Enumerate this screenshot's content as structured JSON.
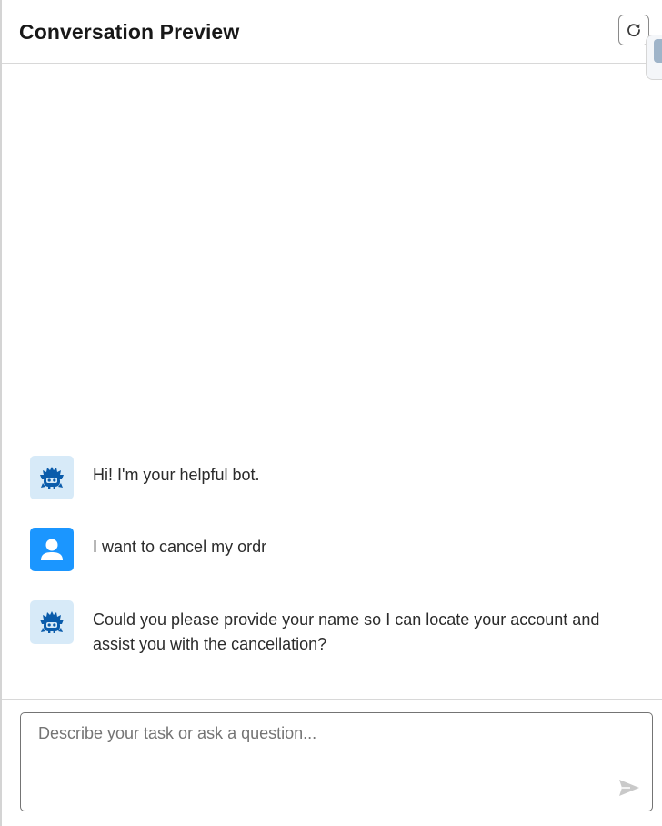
{
  "header": {
    "title": "Conversation Preview",
    "refresh_icon": "refresh-icon"
  },
  "messages": [
    {
      "sender": "bot",
      "avatar_icon": "bot-avatar-icon",
      "text": "Hi! I'm your helpful bot."
    },
    {
      "sender": "user",
      "avatar_icon": "user-avatar-icon",
      "text": "I want to cancel my ordr"
    },
    {
      "sender": "bot",
      "avatar_icon": "bot-avatar-icon",
      "text": "Could you please provide your name so I can locate your account and assist you with the cancellation?"
    }
  ],
  "composer": {
    "placeholder": "Describe your task or ask a question...",
    "value": "",
    "send_icon": "send-icon"
  },
  "colors": {
    "bot_avatar_bg": "#d7eaf8",
    "bot_avatar_fg": "#0b5cab",
    "user_avatar_bg": "#1b96ff",
    "border": "#d8d8d8"
  }
}
